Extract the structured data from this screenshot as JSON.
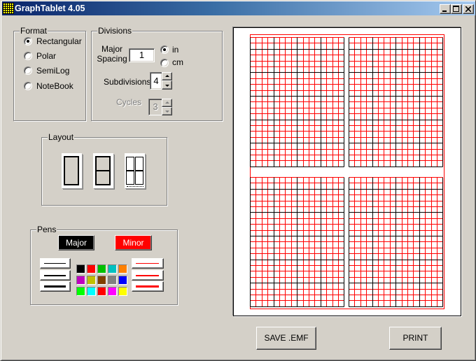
{
  "window": {
    "title": "GraphTablet 4.05",
    "app_icon": "graph-grid-icon",
    "controls": [
      {
        "name": "minimize",
        "icon": "minimize-icon"
      },
      {
        "name": "maximize",
        "icon": "maximize-icon"
      },
      {
        "name": "close",
        "icon": "close-icon"
      }
    ]
  },
  "format": {
    "label": "Format",
    "options": [
      {
        "label": "Rectangular",
        "selected": true
      },
      {
        "label": "Polar",
        "selected": false
      },
      {
        "label": "SemiLog",
        "selected": false
      },
      {
        "label": "NoteBook",
        "selected": false
      }
    ]
  },
  "divisions": {
    "label": "Divisions",
    "major_spacing": {
      "label_line1": "Major",
      "label_line2": "Spacing",
      "value": "1"
    },
    "units": [
      {
        "label": "in",
        "selected": true
      },
      {
        "label": "cm",
        "selected": false
      }
    ],
    "subdivisions": {
      "label": "Subdivisions",
      "value": "4"
    },
    "cycles": {
      "label": "Cycles",
      "value": "3",
      "enabled": false
    }
  },
  "layout": {
    "label": "Layout",
    "options": [
      {
        "name": "single-page",
        "selected": false
      },
      {
        "name": "two-halves",
        "selected": false
      },
      {
        "name": "four-quarters",
        "selected": true
      }
    ]
  },
  "pens": {
    "label": "Pens",
    "major": {
      "label": "Major",
      "color": "#000000",
      "text_color": "#ffffff"
    },
    "minor": {
      "label": "Minor",
      "color": "#ff0000",
      "text_color": "#ffffff"
    },
    "widths": [
      "thin",
      "medium",
      "thick"
    ],
    "palette": [
      "#000000",
      "#ff0000",
      "#00c000",
      "#00c0c0",
      "#ff8000",
      "#c000c0",
      "#c0c000",
      "#804000",
      "#808080",
      "#0000ff",
      "#00ff00",
      "#00ffff",
      "#ff0000",
      "#ff00ff",
      "#ffff00"
    ]
  },
  "preview": {
    "panels": 4,
    "subdivisions": 4,
    "major_color": "#000000",
    "minor_color": "#ff0000",
    "border_color": "#ff0000"
  },
  "actions": {
    "save_label": "SAVE .EMF",
    "print_label": "PRINT"
  }
}
